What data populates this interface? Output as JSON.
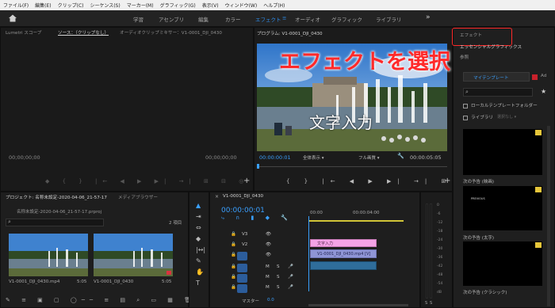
{
  "menu": [
    "ファイル(F)",
    "編集(E)",
    "クリップ(C)",
    "シーケンス(S)",
    "マーカー(M)",
    "グラフィック(G)",
    "表示(V)",
    "ウィンドウ(W)",
    "ヘルプ(H)"
  ],
  "workspaces": [
    {
      "label": "学習",
      "active": false
    },
    {
      "label": "アセンブリ",
      "active": false
    },
    {
      "label": "編集",
      "active": false
    },
    {
      "label": "カラー",
      "active": false
    },
    {
      "label": "エフェクト",
      "active": true
    },
    {
      "label": "オーディオ",
      "active": false
    },
    {
      "label": "グラフィック",
      "active": false
    },
    {
      "label": "ライブラリ",
      "active": false
    }
  ],
  "source_panel": {
    "tabs": [
      "Lumetri スコープ",
      "ソース：（クリップなし）",
      "オーディオクリップミキサー：V1-0001_DJI_0430"
    ],
    "tc_left": "00;00;00;00",
    "tc_right": "00;00;00;00"
  },
  "program": {
    "tab": "プログラム: V1-0001_DJI_0430",
    "overlay_text": "文字入力",
    "annotation": "エフェクトを選択",
    "tc_left": "00:00:00:01",
    "fit": "全体表示",
    "quality": "フル画質",
    "tc_right": "00:00:05:05"
  },
  "project": {
    "tab": "プロジェクト: 名称未設定-2020-04-06_21-57-17",
    "tab2": "メディアブラウザー",
    "file": "名称未設定-2020-04-06_21-57-17.prproj",
    "count": "2 項目",
    "items": [
      {
        "name": "V1-0001_DJI_0430.mp4",
        "dur": "5:05"
      },
      {
        "name": "V1-0001_DJI_0430",
        "dur": "5:05"
      }
    ]
  },
  "timeline": {
    "tab": "V1-0001_DJI_0430",
    "tc": "00:00:00:01",
    "ruler": [
      "00:00",
      "00:00:04:00"
    ],
    "tracks": [
      "V3",
      "V2",
      "V1",
      "A1",
      "A2",
      "A3"
    ],
    "master": "マスター",
    "master_value": "0.0",
    "clips": {
      "title": "文字入力",
      "video": "V1-0001_DJI_0430.mp4 [V]"
    }
  },
  "meter_labels": [
    "0",
    "-6",
    "-12",
    "-18",
    "-24",
    "-30",
    "-36",
    "-42",
    "-48",
    "-54",
    "dB"
  ],
  "meter_bottom": [
    "S",
    "S"
  ],
  "effects": {
    "tab": "エフェクト",
    "tab2": "エッセンシャルグラフィックス",
    "tab3": "参照",
    "template_tab": "マイテンプレート",
    "template_tab2": "Ad",
    "local_folder": "ローカルテンプレートフォルダー",
    "library": "ライブラリ",
    "library_select": "選択なし",
    "items": [
      {
        "caption": "次の予告 (映画)"
      },
      {
        "caption": "次の予告 (太字)",
        "thumb_text": "PREVIOUS"
      },
      {
        "caption": "次の予告 (クラシック)"
      }
    ]
  },
  "colors": {
    "accent": "#2d8ceb",
    "annotation": "#ff2a2a",
    "title_clip": "#f4a3e6",
    "video_clip": "#8f95d6"
  }
}
